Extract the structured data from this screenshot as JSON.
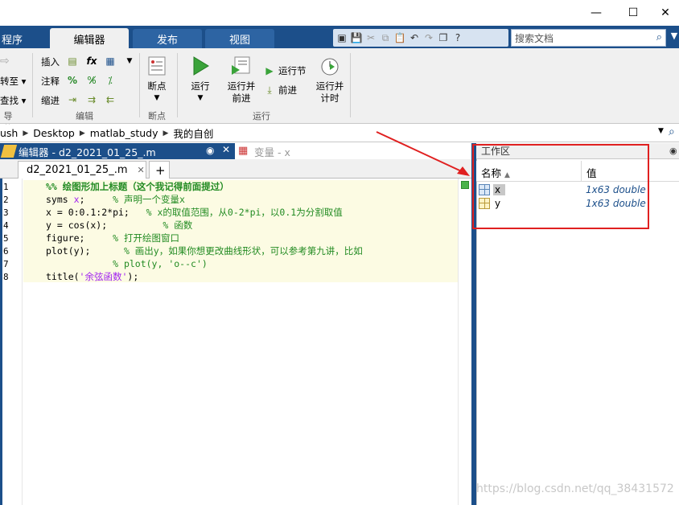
{
  "window": {
    "minimize": "—",
    "maximize": "☐",
    "close": "✕"
  },
  "tabs": [
    {
      "label": "程序"
    },
    {
      "label": "编辑器"
    },
    {
      "label": "发布"
    },
    {
      "label": "视图"
    }
  ],
  "search": {
    "placeholder": "搜索文档"
  },
  "ribbon": {
    "nav_label_1": "转至",
    "nav_label_2": "查找",
    "nav_group": "导航",
    "insert": "插入",
    "fx": "fx",
    "comment": "注释",
    "indent": "缩进",
    "edit_group": "编辑",
    "breakpoints": "断点",
    "breakpoints_group": "断点",
    "run": "运行",
    "run_advance_1": "运行并",
    "run_advance_2": "前进",
    "run_section": "运行节",
    "advance": "前进",
    "run_time_1": "运行并",
    "run_time_2": "计时",
    "run_group": "运行"
  },
  "address": {
    "crumbs": [
      "ush",
      "Desktop",
      "matlab_study",
      "我的自创"
    ]
  },
  "editor": {
    "title": "编辑器 - d2_2021_01_25_.m",
    "var_title": "变量 - x",
    "file_tab": "d2_2021_01_25_.m",
    "add_tab": "+",
    "lines": [
      {
        "no": "1",
        "code": "%% 绘图形加上标题（这个我记得前面提过）"
      },
      {
        "no": "2",
        "a": "syms ",
        "b": "x",
        "c": ";     ",
        "d": "% 声明一个变量x"
      },
      {
        "no": "3",
        "a": "x = 0:0.1:2*pi;   ",
        "d": "% x的取值范围，从0-2*pi，以0.1为分割取值"
      },
      {
        "no": "4",
        "a": "y = cos(x);          ",
        "d": "% 函数"
      },
      {
        "no": "5",
        "a": "figure;     ",
        "d": "% 打开绘图窗口"
      },
      {
        "no": "6",
        "a": "plot(y);      ",
        "d": "% 画出y，如果你想更改曲线形状，可以参考第九讲，比如"
      },
      {
        "no": "7",
        "a": "            ",
        "d": "% plot(y, 'o--c')"
      },
      {
        "no": "8",
        "a": "title(",
        "s": "'余弦函数'",
        "c": ");"
      }
    ]
  },
  "workspace": {
    "title": "工作区",
    "col_name": "名称",
    "col_value": "值",
    "rows": [
      {
        "name": "x",
        "value": "1x63 double"
      },
      {
        "name": "y",
        "value": "1x63 double"
      }
    ]
  },
  "watermark": "https://blog.csdn.net/qq_38431572",
  "colors": {
    "accent": "#1c4f8a",
    "annotation": "#e02020"
  }
}
